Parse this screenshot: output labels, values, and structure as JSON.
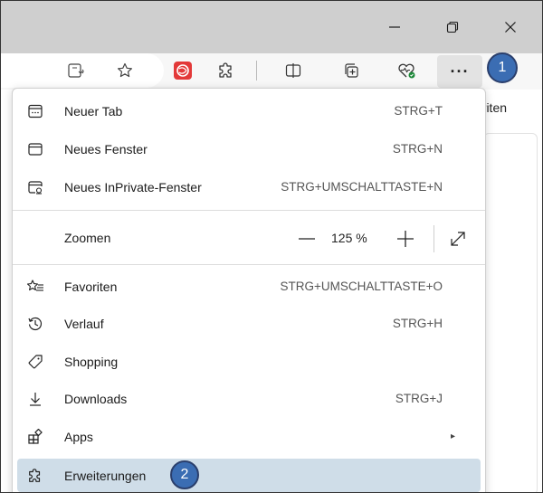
{
  "window": {
    "minimize_icon": "minimize-icon",
    "restore_icon": "restore-icon",
    "close_icon": "close-icon"
  },
  "toolbar": {
    "more_label": "···",
    "icons": [
      "reader-view-icon",
      "favorite-star-icon",
      "extension-red-icon",
      "extensions-puzzle-icon",
      "split-screen-icon",
      "collections-icon",
      "browser-essentials-icon"
    ]
  },
  "badges": {
    "step1": "1",
    "step2": "2"
  },
  "background_page": {
    "tab_fragment": "oriten",
    "letter_fragment": "n"
  },
  "menu": {
    "items": [
      {
        "label": "Neuer Tab",
        "shortcut": "STRG+T",
        "icon": "new-tab-icon"
      },
      {
        "label": "Neues Fenster",
        "shortcut": "STRG+N",
        "icon": "new-window-icon"
      },
      {
        "label": "Neues InPrivate-Fenster",
        "shortcut": "STRG+UMSCHALTTASTE+N",
        "icon": "inprivate-window-icon"
      },
      {
        "label": "Favoriten",
        "shortcut": "STRG+UMSCHALTTASTE+O",
        "icon": "favorites-icon"
      },
      {
        "label": "Verlauf",
        "shortcut": "STRG+H",
        "icon": "history-icon"
      },
      {
        "label": "Shopping",
        "shortcut": "",
        "icon": "shopping-tag-icon"
      },
      {
        "label": "Downloads",
        "shortcut": "STRG+J",
        "icon": "download-icon"
      },
      {
        "label": "Apps",
        "shortcut": "",
        "icon": "apps-icon",
        "submenu": "▸"
      },
      {
        "label": "Erweiterungen",
        "shortcut": "",
        "icon": "extensions-icon",
        "highlighted": true
      }
    ],
    "zoom": {
      "label": "Zoomen",
      "minus": "—",
      "value": "125 %",
      "plus": "+"
    }
  },
  "colors": {
    "badge_blue": "#3b6db3",
    "highlight": "#cfdde8",
    "titlebar": "#cfcfcf"
  }
}
